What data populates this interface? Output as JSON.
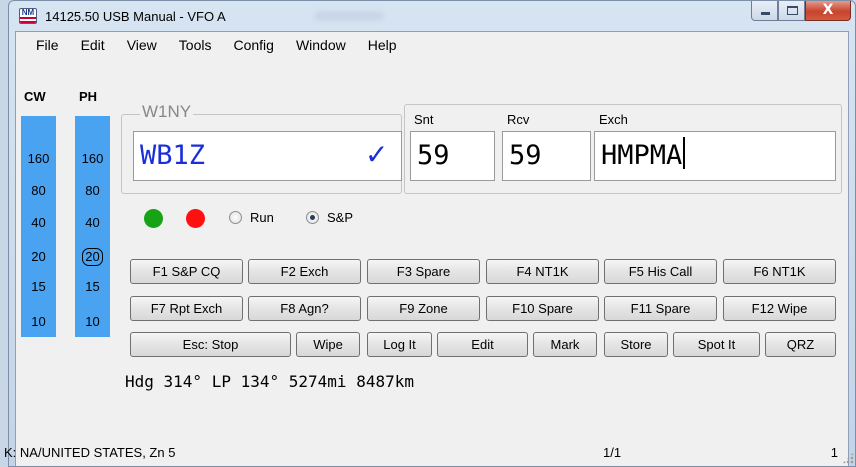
{
  "window": {
    "title": "14125.50 USB Manual - VFO A",
    "app_icon_text": "NM",
    "close_glyph": "X"
  },
  "menu": [
    "File",
    "Edit",
    "View",
    "Tools",
    "Config",
    "Window",
    "Help"
  ],
  "bands": {
    "cw_header": "CW",
    "ph_header": "PH",
    "cw": [
      "160",
      "80",
      "40",
      "20",
      "15",
      "10"
    ],
    "ph": [
      "160",
      "80",
      "40",
      "20",
      "15",
      "10"
    ],
    "selected_ph": "20",
    "color": "#4aa3f0"
  },
  "entry": {
    "group_label": "W1NY",
    "callsign": "WB1Z",
    "check_glyph": "✓",
    "snt_label": "Snt",
    "snt_value": "59",
    "rcv_label": "Rcv",
    "rcv_value": "59",
    "exch_label": "Exch",
    "exch_value": "HMPMA",
    "callsign_color": "#1a2fd8"
  },
  "indicators": {
    "green": "#16a316",
    "red": "#ff0f0f"
  },
  "mode": {
    "run_label": "Run",
    "sp_label": "S&P",
    "selected": "S&P"
  },
  "function_keys": [
    [
      "F1 S&P CQ",
      "F2 Exch",
      "F3 Spare",
      "F4 NT1K",
      "F5 His Call",
      "F6 NT1K"
    ],
    [
      "F7 Rpt Exch",
      "F8 Agn?",
      "F9 Zone",
      "F10 Spare",
      "F11 Spare",
      "F12 Wipe"
    ]
  ],
  "action_buttons": [
    "Esc: Stop",
    "Wipe",
    "Log It",
    "Edit",
    "Mark",
    "Store",
    "Spot It",
    "QRZ"
  ],
  "info_line": "Hdg 314° LP 134° 5274mi 8487km",
  "status": {
    "left": "K: NA/UNITED STATES, Zn 5",
    "middle": "1/1",
    "right": "1"
  }
}
